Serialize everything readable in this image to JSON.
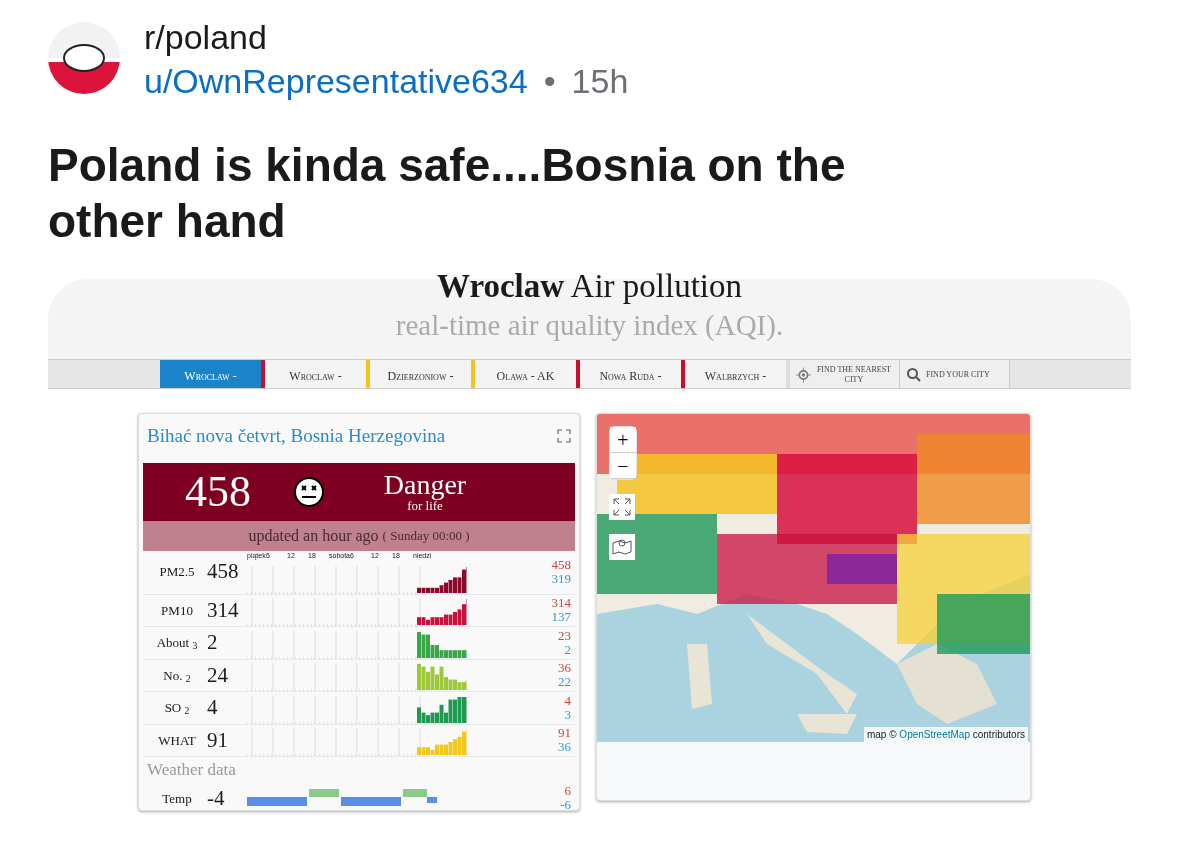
{
  "post": {
    "subreddit": "r/poland",
    "author": "u/OwnRepresentative634",
    "separator": "•",
    "age": "15h",
    "title": "Poland is kinda safe....Bosnia on the other hand"
  },
  "site": {
    "heading_bold": "Wroclaw",
    "heading_rest": "Air pollution",
    "subtitle": "real-time air quality index (AQI).",
    "nav": [
      {
        "label": "Wroclaw -",
        "selected": true,
        "color": "#c8102e"
      },
      {
        "label": "Wroclaw -",
        "selected": false,
        "color": "#f0c419"
      },
      {
        "label": "Dzierzoniow -",
        "selected": false,
        "color": "#f0c419"
      },
      {
        "label": "Olawa - AK",
        "selected": false,
        "color": "#c8102e"
      },
      {
        "label": "Nowa Ruda -",
        "selected": false,
        "color": "#c8102e"
      },
      {
        "label": "Walbrzych -",
        "selected": false,
        "color": "#dddddd"
      }
    ],
    "find_nearest": "FIND THE NEAREST CITY",
    "find_city": "FIND YOUR CITY"
  },
  "station": {
    "name": "Bihać nova četvrt, Bosnia Herzegovina",
    "aqi": "458",
    "level": "Danger",
    "level_note": "for life",
    "updated": "updated an hour ago",
    "updated_time": "( Sunday 00:00 )",
    "axis_labels": [
      "piątek",
      "6",
      "12",
      "18",
      "sobota",
      "6",
      "12",
      "18",
      "niedzi"
    ],
    "pollutants": [
      {
        "name": "PM2.5",
        "value": "458",
        "max": "458",
        "min": "319",
        "color": "#8b0a2a"
      },
      {
        "name": "PM10",
        "value": "314",
        "max": "314",
        "min": "137",
        "color": "#c8103e"
      },
      {
        "name": "About $_{3}$",
        "value": "2",
        "max": "23",
        "min": "2",
        "color": "#3aa64a"
      },
      {
        "name": "No. $_{2}$",
        "value": "24",
        "max": "36",
        "min": "22",
        "color": "#9cc83a"
      },
      {
        "name": "SO $_{2}$",
        "value": "4",
        "max": "4",
        "min": "3",
        "color": "#1d9a4f"
      },
      {
        "name": "WHAT",
        "value": "91",
        "max": "91",
        "min": "36",
        "color": "#f2c81a"
      }
    ],
    "weather_heading": "Weather data",
    "weather": [
      {
        "name": "Temp",
        "value": "-4",
        "max": "6",
        "min": "-6"
      }
    ]
  },
  "map": {
    "zoom_in": "+",
    "zoom_out": "−",
    "attribution_prefix": "map ©",
    "attribution_link": "OpenStreetMap",
    "attribution_suffix": "contributors"
  }
}
